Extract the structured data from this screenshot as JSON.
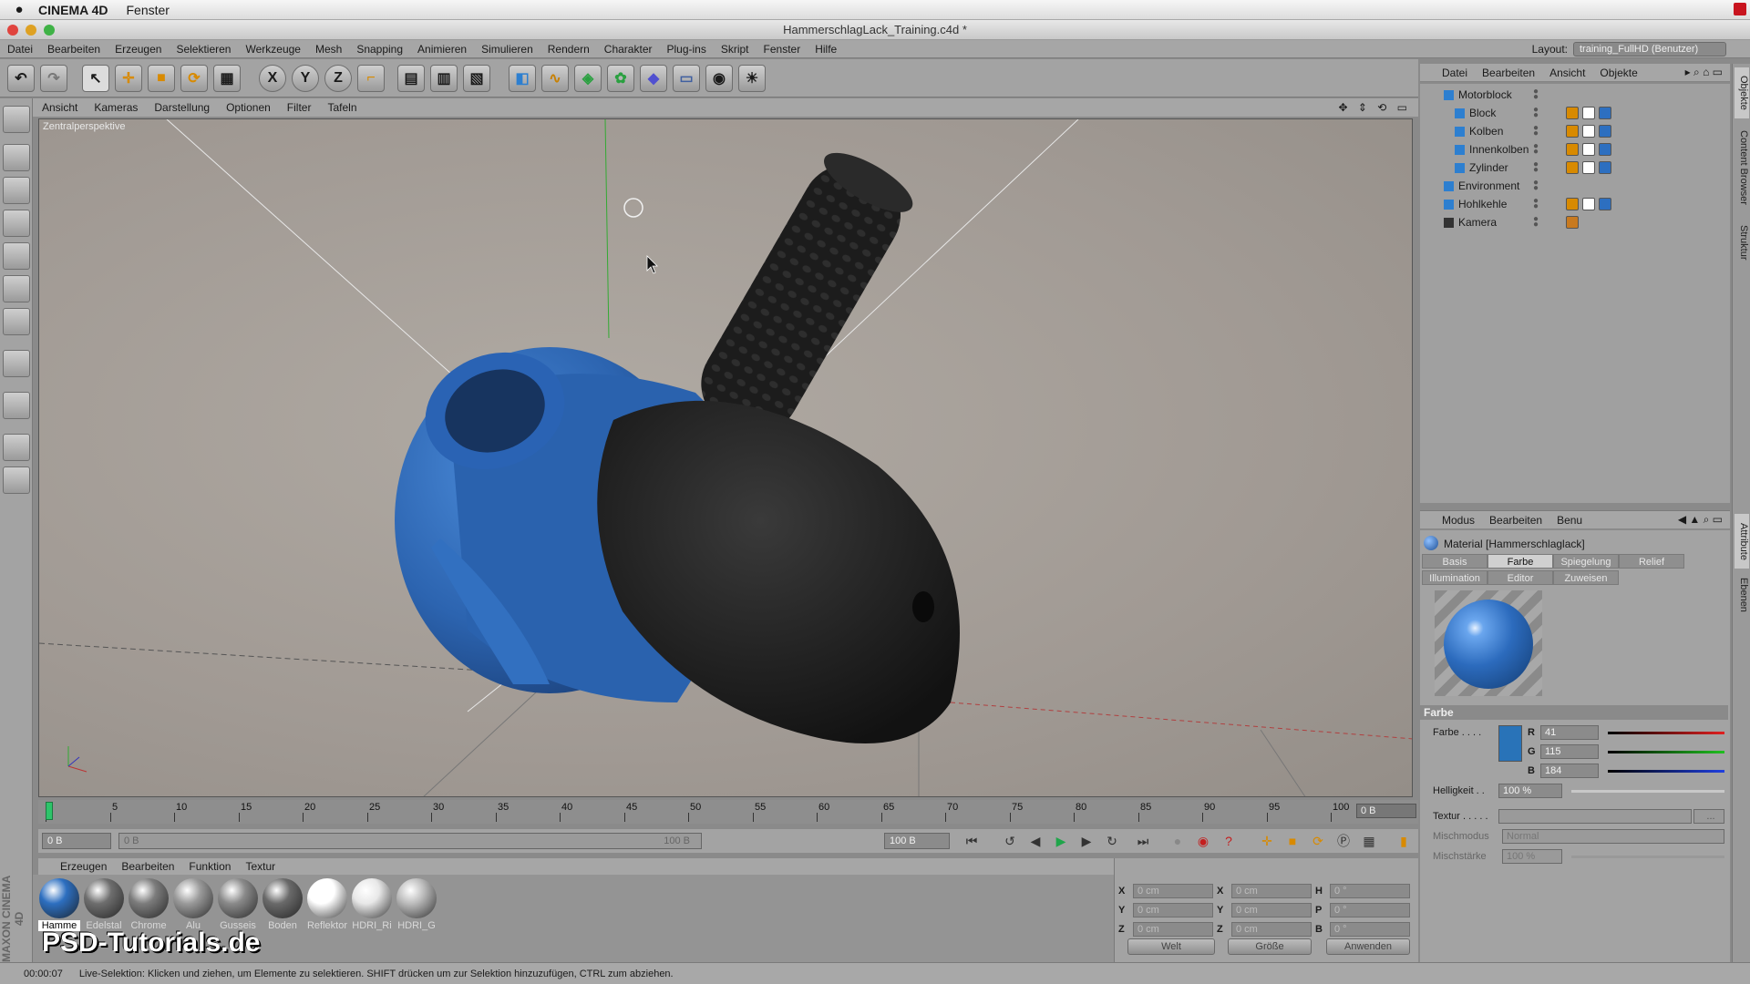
{
  "macbar": {
    "app": "CINEMA 4D",
    "menu": "Fenster"
  },
  "window": {
    "title": "HammerschlagLack_Training.c4d *"
  },
  "menu": [
    "Datei",
    "Bearbeiten",
    "Erzeugen",
    "Selektieren",
    "Werkzeuge",
    "Mesh",
    "Snapping",
    "Animieren",
    "Simulieren",
    "Rendern",
    "Charakter",
    "Plug-ins",
    "Skript",
    "Fenster",
    "Hilfe"
  ],
  "layout": {
    "label": "Layout:",
    "value": "training_FullHD (Benutzer)"
  },
  "toolbar": {
    "x_axis": "X",
    "y_axis": "Y",
    "z_axis": "Z"
  },
  "viewport": {
    "menu": [
      "Ansicht",
      "Kameras",
      "Darstellung",
      "Optionen",
      "Filter",
      "Tafeln"
    ],
    "label": "Zentralperspektive",
    "nav_icons": "✥ ⇕ ⟲ ▭"
  },
  "timeline": {
    "ticks": [
      "0",
      "5",
      "10",
      "15",
      "20",
      "25",
      "30",
      "35",
      "40",
      "45",
      "50",
      "55",
      "60",
      "65",
      "70",
      "75",
      "80",
      "85",
      "90",
      "95",
      "100"
    ],
    "frame_field": "0 B",
    "start_field": "0 B",
    "range_start": "0 B",
    "range_end": "100 B",
    "end_field": "100 B"
  },
  "materials": {
    "menu": [
      "Erzeugen",
      "Bearbeiten",
      "Funktion",
      "Textur"
    ],
    "items": [
      {
        "name": "Hamme",
        "color": "#2d6fc0",
        "selected": true
      },
      {
        "name": "Edelstal",
        "color": "#6e6e6e",
        "selected": false
      },
      {
        "name": "Chrome",
        "color": "#7c7c7c",
        "selected": false
      },
      {
        "name": "Alu",
        "color": "#9a9a9a",
        "selected": false
      },
      {
        "name": "Gusseis",
        "color": "#8a8a8a",
        "selected": false
      },
      {
        "name": "Boden",
        "color": "#6a6a6a",
        "selected": false
      },
      {
        "name": "Reflektor",
        "color": "#ffffff",
        "selected": false
      },
      {
        "name": "HDRI_Ri",
        "color": "#e8e8e8",
        "selected": false
      },
      {
        "name": "HDRI_G",
        "color": "#bcbcbc",
        "selected": false
      }
    ],
    "watermark": "PSD-Tutorials.de",
    "maxon": "MAXON CINEMA 4D"
  },
  "coords": {
    "rows": [
      {
        "a": "X",
        "av": "0 cm",
        "b": "X",
        "bv": "0 cm",
        "c": "H",
        "cv": "0 °"
      },
      {
        "a": "Y",
        "av": "0 cm",
        "b": "Y",
        "bv": "0 cm",
        "c": "P",
        "cv": "0 °"
      },
      {
        "a": "Z",
        "av": "0 cm",
        "b": "Z",
        "bv": "0 cm",
        "c": "B",
        "cv": "0 °"
      }
    ],
    "world": "Welt",
    "size": "Größe",
    "apply": "Anwenden"
  },
  "status": {
    "time": "00:00:07",
    "text": "Live-Selektion: Klicken und ziehen, um Elemente zu selektieren. SHIFT drücken um zur Selektion hinzuzufügen, CTRL zum abziehen."
  },
  "objects": {
    "menu": [
      "Datei",
      "Bearbeiten",
      "Ansicht",
      "Objekte"
    ],
    "tree": [
      {
        "name": "Motorblock",
        "indent": 0
      },
      {
        "name": "Block",
        "indent": 1
      },
      {
        "name": "Kolben",
        "indent": 1
      },
      {
        "name": "Innenkolben",
        "indent": 1
      },
      {
        "name": "Zylinder",
        "indent": 1
      },
      {
        "name": "Environment",
        "indent": 0
      },
      {
        "name": "Hohlkehle",
        "indent": 0
      },
      {
        "name": "Kamera",
        "indent": 0
      }
    ]
  },
  "attributes": {
    "menu": [
      "Modus",
      "Bearbeiten",
      "Benu"
    ],
    "material_title": "Material [Hammerschlaglack]",
    "tabs_row1": [
      "Basis",
      "Farbe",
      "Spiegelung",
      "Relief"
    ],
    "tabs_row2": [
      "Illumination",
      "Editor",
      "Zuweisen"
    ],
    "section": "Farbe",
    "color_label": "Farbe . . . .",
    "r_label": "R",
    "r": "41",
    "g_label": "G",
    "g": "115",
    "b_label": "B",
    "b": "184",
    "brightness_label": "Helligkeit . .",
    "brightness": "100 %",
    "texture_label": "Textur . . . . .",
    "texture_btn": "...",
    "mix_mode_label": "Mischmodus",
    "mix_mode": "Normal",
    "mix_strength_label": "Mischstärke",
    "mix_strength": "100 %",
    "swatch_color": "#2973b8"
  },
  "vtabs": [
    "Objekte",
    "Content Browser",
    "Struktur",
    "Attribute",
    "Ebenen"
  ]
}
